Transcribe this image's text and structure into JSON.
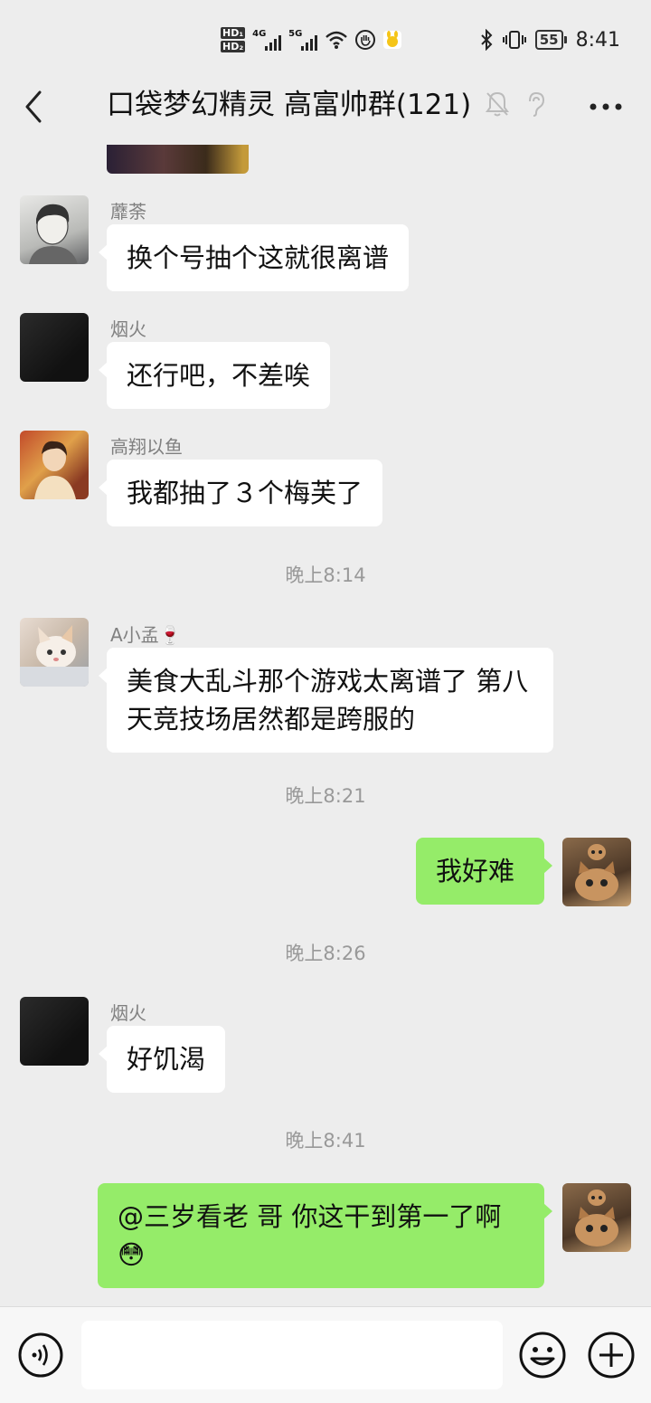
{
  "status_bar": {
    "hd1": "HD₁",
    "hd2": "HD₂",
    "net1": "4G",
    "net2": "5G",
    "battery": "55",
    "time": "8:41"
  },
  "header": {
    "title": "口袋梦幻精灵 高富帅群(121)"
  },
  "messages": [
    {
      "type": "text",
      "side": "left",
      "sender": "蘼荼",
      "text": "换个号抽个这就很离谱"
    },
    {
      "type": "text",
      "side": "left",
      "sender": "烟火",
      "text": "还行吧，不差唉"
    },
    {
      "type": "text",
      "side": "left",
      "sender": "高翔以鱼",
      "text": "我都抽了３个梅芙了"
    },
    {
      "type": "time",
      "text": "晚上8:14"
    },
    {
      "type": "text",
      "side": "left",
      "sender": "A小孟🍷",
      "text": "美食大乱斗那个游戏太离谱了 第八天竞技场居然都是跨服的"
    },
    {
      "type": "time",
      "text": "晚上8:21"
    },
    {
      "type": "text",
      "side": "right",
      "text": "我好难"
    },
    {
      "type": "time",
      "text": "晚上8:26"
    },
    {
      "type": "text",
      "side": "left",
      "sender": "烟火",
      "text": "好饥渴"
    },
    {
      "type": "time",
      "text": "晚上8:41"
    },
    {
      "type": "text",
      "side": "right",
      "text": "@三岁看老  哥 你这干到第一了啊😳"
    }
  ],
  "input": {
    "placeholder": ""
  },
  "icons": {
    "back": "back-arrow-icon",
    "mute": "mute-bell-icon",
    "ear": "earpiece-icon",
    "more": "more-dots-icon",
    "voice": "voice-icon",
    "emoji": "emoji-icon",
    "plus": "plus-icon"
  },
  "colors": {
    "background": "#ededed",
    "bubble_self": "#95ec69",
    "bubble_other": "#ffffff",
    "timestamp": "#999999",
    "sender": "#808080"
  }
}
